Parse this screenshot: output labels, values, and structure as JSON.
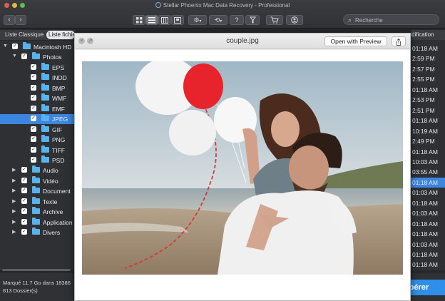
{
  "window": {
    "title": "Stellar Phoenix Mac Data Recovery - Professional",
    "traffic_colors": [
      "#e25a50",
      "#e2b73a",
      "#5bbf4a"
    ]
  },
  "toolbar": {
    "back_glyph": "‹",
    "forward_glyph": "›",
    "view_icons": [
      "grid-view-icon",
      "list-view-icon",
      "column-view-icon",
      "coverflow-view-icon"
    ],
    "action_icons": [
      "gear-icon",
      "history-icon",
      "help-icon",
      "filter-icon",
      "cart-icon",
      "user-icon"
    ],
    "help_glyph": "?",
    "search_placeholder": "Recherche"
  },
  "tabs": [
    {
      "label": "Liste Classique",
      "selected": false
    },
    {
      "label": "Liste fichiers",
      "selected": true
    }
  ],
  "tree": [
    {
      "label": "Macintosh HD",
      "level": 0,
      "expanded": true
    },
    {
      "label": "Photos",
      "level": 1,
      "expanded": true
    },
    {
      "label": "EPS",
      "level": 2
    },
    {
      "label": "INDD",
      "level": 2
    },
    {
      "label": "BMP",
      "level": 2
    },
    {
      "label": "WMF",
      "level": 2
    },
    {
      "label": "EMF",
      "level": 2
    },
    {
      "label": "JPEG",
      "level": 2,
      "selected": true
    },
    {
      "label": "GIF",
      "level": 2
    },
    {
      "label": "PNG",
      "level": 2
    },
    {
      "label": "TIFF",
      "level": 2
    },
    {
      "label": "PSD",
      "level": 2
    },
    {
      "label": "Audio",
      "level": 1,
      "expanded": false
    },
    {
      "label": "Vidéo",
      "level": 1,
      "expanded": false
    },
    {
      "label": "Document",
      "level": 1,
      "expanded": false
    },
    {
      "label": "Texte",
      "level": 1,
      "expanded": false
    },
    {
      "label": "Archive",
      "level": 1,
      "expanded": false
    },
    {
      "label": "Application",
      "level": 1,
      "expanded": false
    },
    {
      "label": "Divers",
      "level": 1,
      "expanded": false
    }
  ],
  "time_column": {
    "header": "dification",
    "values": [
      "01:18 AM",
      "2:59 PM",
      "2:57 PM",
      "2:55 PM",
      "01:18 AM",
      "2:53 PM",
      "2:51 PM",
      "01:18 AM",
      "10:19 AM",
      "2:49 PM",
      "01:18 AM",
      "10:03 AM",
      "03:55 AM",
      "01:18 AM",
      "01:03 AM",
      "01:18 AM",
      "01:03 AM",
      "01:18 AM",
      "01:18 AM",
      "01:03 AM",
      "01:18 AM",
      "01:18 AM",
      "01:18 AM",
      "01:18 AM"
    ],
    "selected_index": 13
  },
  "status": {
    "line1": "Marqué 11.7 Go dans 18386",
    "line2": "813 Dossier(s)",
    "recover_label": "upérer"
  },
  "preview": {
    "filename": "couple.jpg",
    "open_label": "Open with Preview",
    "close_glyph": "×",
    "fullscreen_glyph": "↗"
  }
}
